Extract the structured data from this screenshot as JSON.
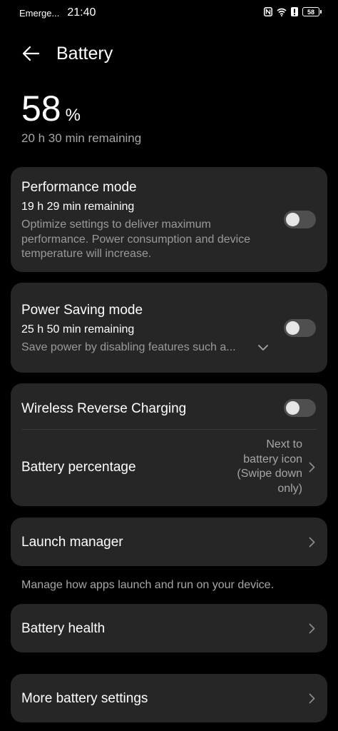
{
  "status_bar": {
    "carrier": "Emerge...",
    "time": "21:40",
    "battery": "58",
    "icons": [
      "nfc-icon",
      "wifi-icon",
      "alert-icon",
      "battery-icon"
    ]
  },
  "header": {
    "title": "Battery",
    "back_icon": "arrow-left-icon"
  },
  "battery": {
    "level": "58",
    "unit": "%",
    "remaining": "20 h 30 min remaining"
  },
  "performance_mode": {
    "title": "Performance mode",
    "remaining": "19 h 29 min remaining",
    "description": "Optimize settings to deliver maximum performance. Power consumption and device temperature will increase.",
    "enabled": false
  },
  "power_saving_mode": {
    "title": "Power Saving mode",
    "remaining": "25 h 50 min remaining",
    "description": "Save power by disabling features such a...",
    "enabled": false
  },
  "wireless_reverse_charging": {
    "title": "Wireless Reverse Charging",
    "enabled": false
  },
  "battery_percentage": {
    "title": "Battery percentage",
    "value_lines": [
      "Next to",
      "battery icon",
      "(Swipe down",
      "only)"
    ]
  },
  "launch_manager": {
    "title": "Launch manager",
    "note": "Manage how apps launch and run on your device."
  },
  "battery_health": {
    "title": "Battery health"
  },
  "more_settings": {
    "title": "More battery settings"
  },
  "colors": {
    "background": "#000000",
    "card": "#262626",
    "secondary_text": "#a6a6a6",
    "toggle_off": "#4f4f4f"
  }
}
